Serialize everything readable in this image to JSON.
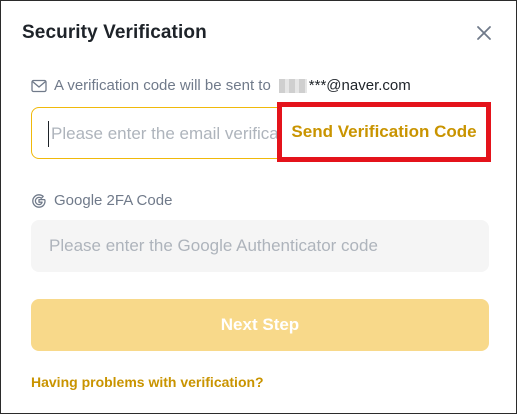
{
  "dialog": {
    "title": "Security Verification"
  },
  "email_section": {
    "notice": "A verification code will be sent to",
    "masked_email": "***@naver.com",
    "input_placeholder": "Please enter the email verification code",
    "send_code_label": "Send Verification Code"
  },
  "google_section": {
    "label": "Google 2FA Code",
    "input_placeholder": "Please enter the Google Authenticator code"
  },
  "actions": {
    "next_label": "Next Step",
    "help_link": "Having problems with verification?"
  },
  "colors": {
    "accent": "#c99400",
    "focus_border": "#f0b90b",
    "highlight_box": "#e4131b",
    "next_button_disabled": "#f8d98a"
  },
  "icons": {
    "close": "close-icon",
    "mail": "mail-icon",
    "google": "google-icon"
  }
}
